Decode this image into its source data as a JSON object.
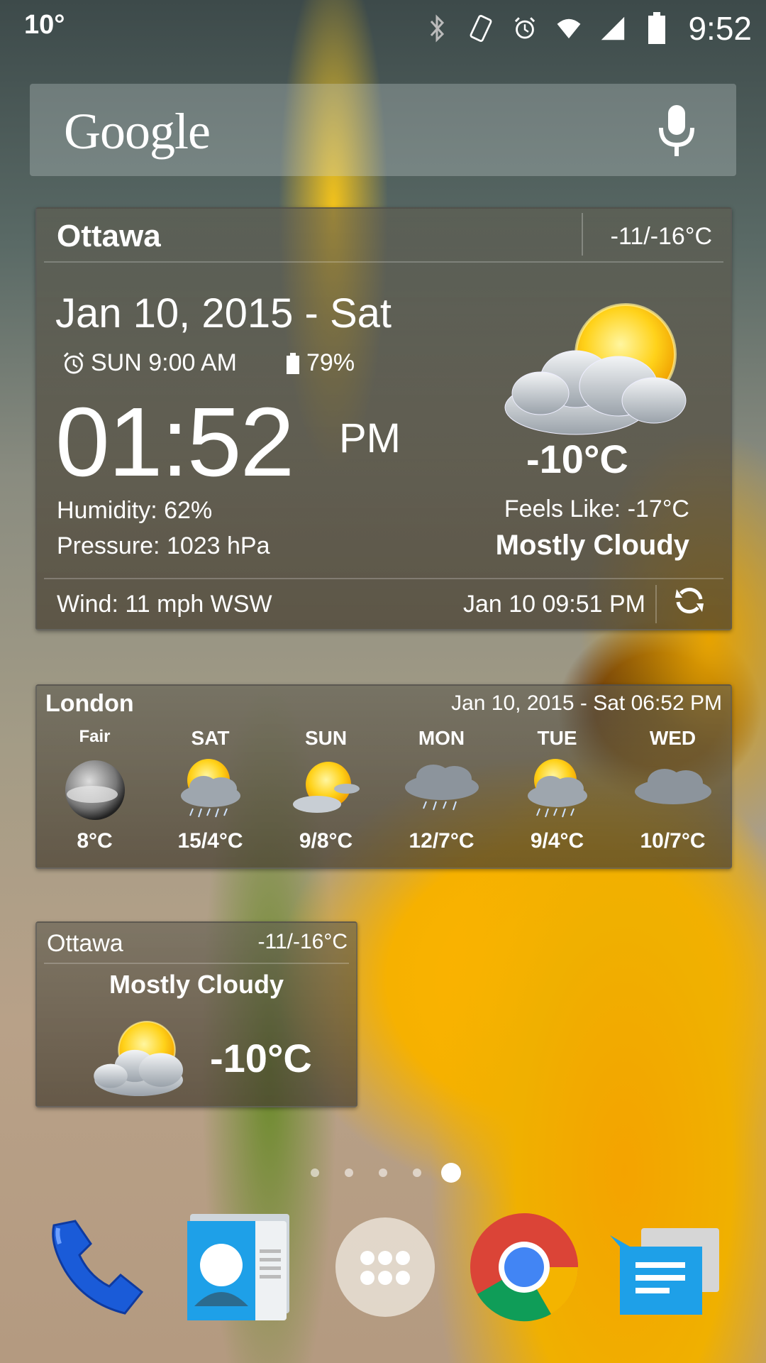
{
  "status_bar": {
    "temp": "10°",
    "time": "9:52",
    "icons": [
      "bluetooth-icon",
      "screen-rotation-icon",
      "alarm-icon",
      "wifi-icon",
      "cell-signal-icon",
      "battery-icon"
    ]
  },
  "google_search": {
    "logo": "Google",
    "icon": "mic-icon"
  },
  "ottawa_widget": {
    "city": "Ottawa",
    "hilo": "-11/-16°C",
    "date": "Jan 10, 2015 - Sat",
    "alarm": "SUN 9:00 AM",
    "battery": "79%",
    "time": "01:52",
    "ampm": "PM",
    "humidity": "Humidity: 62%",
    "pressure": "Pressure: 1023 hPa",
    "temp": "-10°C",
    "feels_like": "Feels Like: -17°C",
    "condition": "Mostly Cloudy",
    "wind": "Wind: 11 mph WSW",
    "updated": "Jan 10  09:51 PM",
    "icon": "partly-cloudy-sun-icon"
  },
  "london_widget": {
    "city": "London",
    "datetime": "Jan 10, 2015 - Sat 06:52 PM",
    "days": [
      {
        "name": "Fair",
        "temp": "8°C",
        "icon": "moon-cloud-icon"
      },
      {
        "name": "SAT",
        "temp": "15/4°C",
        "icon": "sun-rain-icon"
      },
      {
        "name": "SUN",
        "temp": "9/8°C",
        "icon": "sun-cloud-icon"
      },
      {
        "name": "MON",
        "temp": "12/7°C",
        "icon": "rain-cloud-icon"
      },
      {
        "name": "TUE",
        "temp": "9/4°C",
        "icon": "sun-rain-icon"
      },
      {
        "name": "WED",
        "temp": "10/7°C",
        "icon": "cloud-icon"
      }
    ]
  },
  "ottawa_small": {
    "city": "Ottawa",
    "hilo": "-11/-16°C",
    "condition": "Mostly Cloudy",
    "temp": "-10°C",
    "icon": "partly-cloudy-sun-icon"
  },
  "page_indicator": {
    "count": 5,
    "active": 5
  },
  "dock": {
    "apps": [
      {
        "name": "phone-app-icon",
        "label": ""
      },
      {
        "name": "contacts-app-icon",
        "label": ""
      },
      {
        "name": "app-drawer-icon",
        "label": ""
      },
      {
        "name": "chrome-app-icon",
        "label": ""
      },
      {
        "name": "messenger-app-icon",
        "label": ""
      }
    ]
  }
}
